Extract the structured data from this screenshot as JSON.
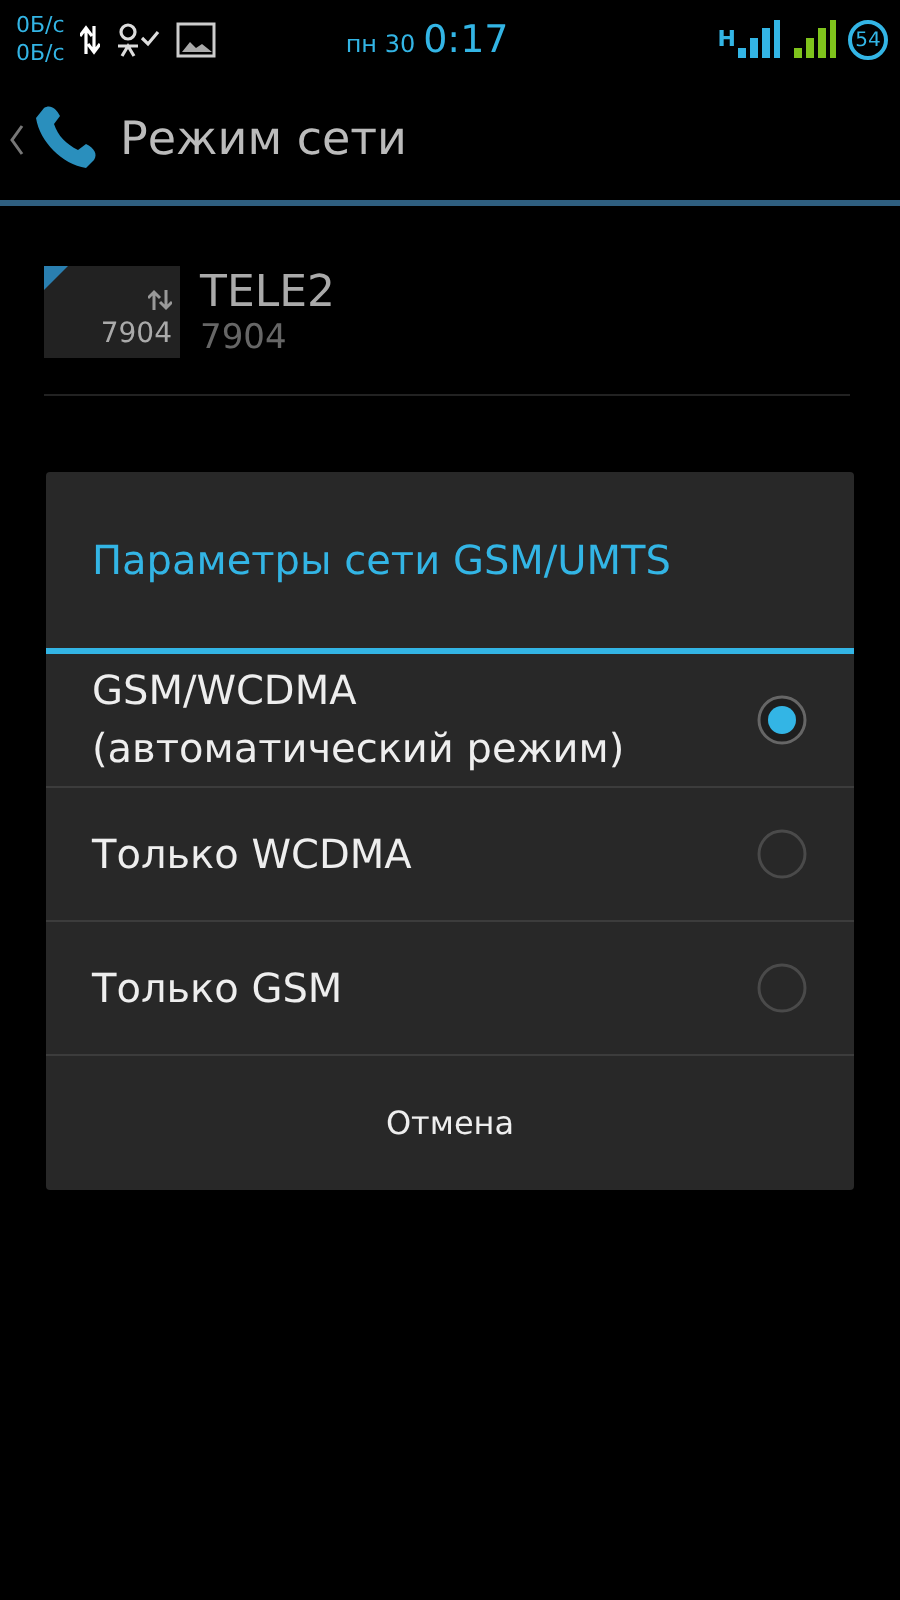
{
  "status_bar": {
    "speed_up": "0Б/с",
    "speed_down": "0Б/с",
    "day": "пн 30",
    "time": "0:17",
    "network_type": "H",
    "battery": "54"
  },
  "action_bar": {
    "title": "Режим сети"
  },
  "sim": {
    "badge": "7904",
    "name": "TELE2",
    "number": "7904"
  },
  "dialog": {
    "title": "Параметры сети GSM/UMTS",
    "options": [
      {
        "label": "GSM/WCDMA (автоматический режим)",
        "selected": true
      },
      {
        "label": "Только WCDMA",
        "selected": false
      },
      {
        "label": "Только GSM",
        "selected": false
      }
    ],
    "cancel": "Отмена"
  }
}
